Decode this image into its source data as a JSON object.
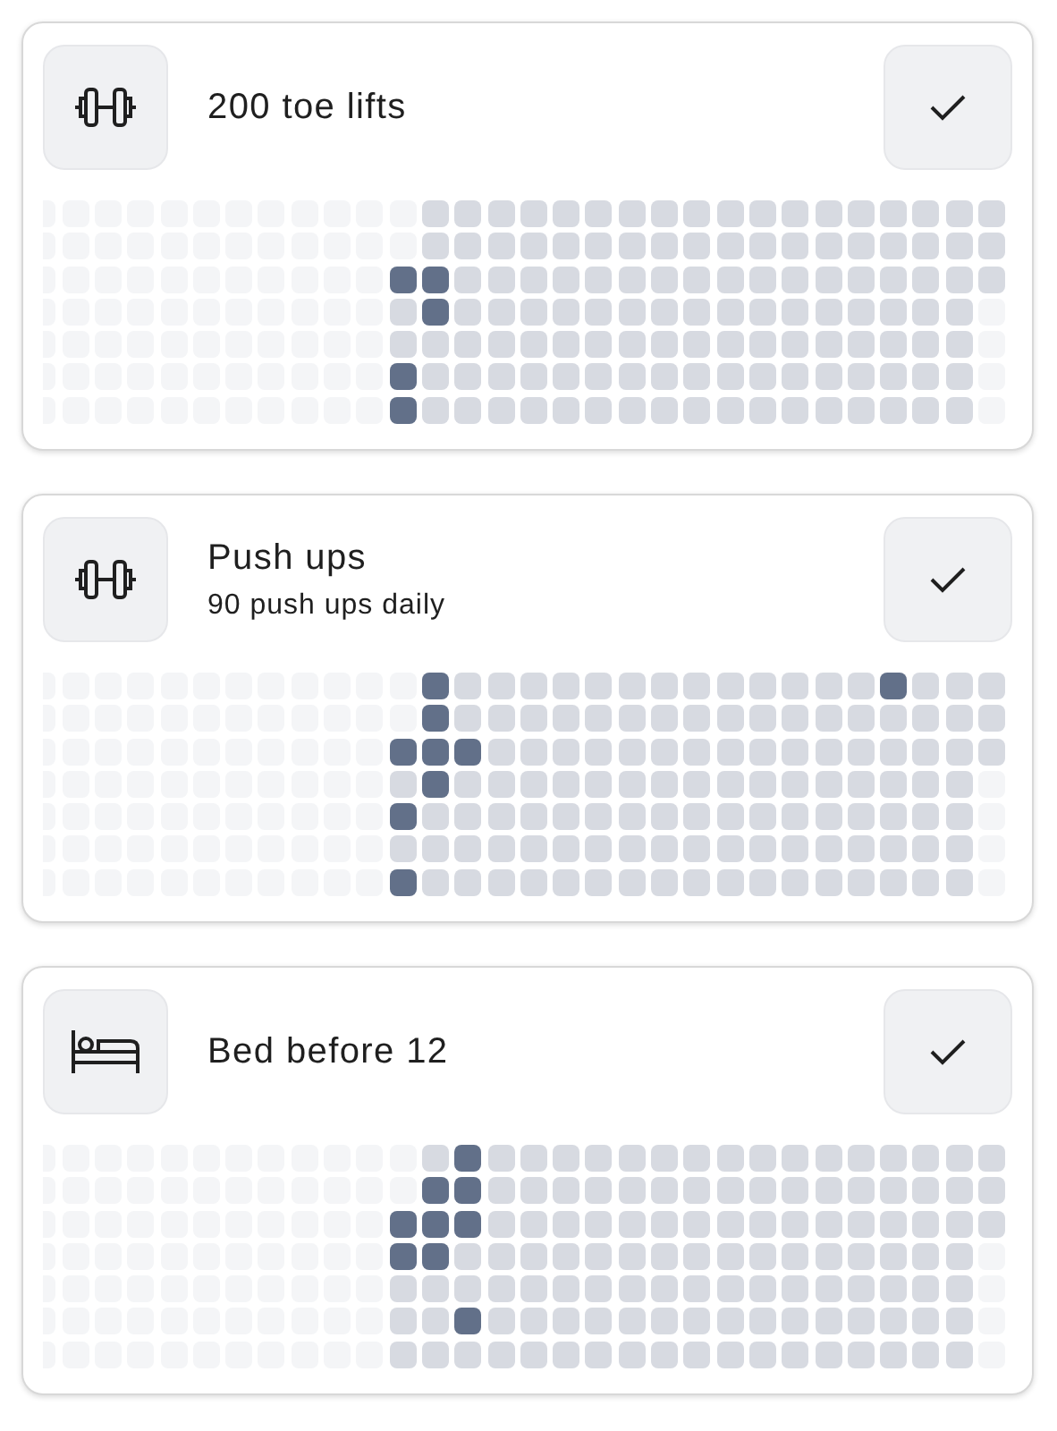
{
  "grid": {
    "disabled": [
      [
        true,
        true,
        true,
        true,
        true,
        true,
        true,
        true,
        true,
        true,
        true,
        true,
        false,
        false,
        false,
        false,
        false,
        false,
        false,
        false,
        false,
        false,
        false,
        false,
        false,
        false,
        false,
        false,
        false,
        false
      ],
      [
        true,
        true,
        true,
        true,
        true,
        true,
        true,
        true,
        true,
        true,
        true,
        true,
        false,
        false,
        false,
        false,
        false,
        false,
        false,
        false,
        false,
        false,
        false,
        false,
        false,
        false,
        false,
        false,
        false,
        false
      ],
      [
        true,
        true,
        true,
        true,
        true,
        true,
        true,
        true,
        true,
        true,
        true,
        false,
        false,
        false,
        false,
        false,
        false,
        false,
        false,
        false,
        false,
        false,
        false,
        false,
        false,
        false,
        false,
        false,
        false,
        false
      ],
      [
        true,
        true,
        true,
        true,
        true,
        true,
        true,
        true,
        true,
        true,
        true,
        false,
        false,
        false,
        false,
        false,
        false,
        false,
        false,
        false,
        false,
        false,
        false,
        false,
        false,
        false,
        false,
        false,
        false,
        true
      ],
      [
        true,
        true,
        true,
        true,
        true,
        true,
        true,
        true,
        true,
        true,
        true,
        false,
        false,
        false,
        false,
        false,
        false,
        false,
        false,
        false,
        false,
        false,
        false,
        false,
        false,
        false,
        false,
        false,
        false,
        true
      ],
      [
        true,
        true,
        true,
        true,
        true,
        true,
        true,
        true,
        true,
        true,
        true,
        false,
        false,
        false,
        false,
        false,
        false,
        false,
        false,
        false,
        false,
        false,
        false,
        false,
        false,
        false,
        false,
        false,
        false,
        true
      ],
      [
        true,
        true,
        true,
        true,
        true,
        true,
        true,
        true,
        true,
        true,
        true,
        false,
        false,
        false,
        false,
        false,
        false,
        false,
        false,
        false,
        false,
        false,
        false,
        false,
        false,
        false,
        false,
        false,
        false,
        true
      ]
    ]
  },
  "habits": [
    {
      "kind": "dumbbell",
      "title": "200 toe lifts",
      "checked": [
        [
          false,
          false,
          false,
          false,
          false,
          false,
          false,
          false,
          false,
          false,
          false,
          false,
          false,
          false,
          false,
          false,
          false,
          false,
          false,
          false,
          false,
          false,
          false,
          false,
          false,
          false,
          false,
          false,
          false,
          false
        ],
        [
          false,
          false,
          false,
          false,
          false,
          false,
          false,
          false,
          false,
          false,
          false,
          false,
          false,
          false,
          false,
          false,
          false,
          false,
          false,
          false,
          false,
          false,
          false,
          false,
          false,
          false,
          false,
          false,
          false,
          false
        ],
        [
          false,
          false,
          false,
          false,
          false,
          false,
          false,
          false,
          false,
          false,
          false,
          true,
          true,
          false,
          false,
          false,
          false,
          false,
          false,
          false,
          false,
          false,
          false,
          false,
          false,
          false,
          false,
          false,
          false,
          false
        ],
        [
          false,
          false,
          false,
          false,
          false,
          false,
          false,
          false,
          false,
          false,
          false,
          false,
          true,
          false,
          false,
          false,
          false,
          false,
          false,
          false,
          false,
          false,
          false,
          false,
          false,
          false,
          false,
          false,
          false,
          false
        ],
        [
          false,
          false,
          false,
          false,
          false,
          false,
          false,
          false,
          false,
          false,
          false,
          false,
          false,
          false,
          false,
          false,
          false,
          false,
          false,
          false,
          false,
          false,
          false,
          false,
          false,
          false,
          false,
          false,
          false,
          false
        ],
        [
          false,
          false,
          false,
          false,
          false,
          false,
          false,
          false,
          false,
          false,
          false,
          true,
          false,
          false,
          false,
          false,
          false,
          false,
          false,
          false,
          false,
          false,
          false,
          false,
          false,
          false,
          false,
          false,
          false,
          false
        ],
        [
          false,
          false,
          false,
          false,
          false,
          false,
          false,
          false,
          false,
          false,
          false,
          true,
          false,
          false,
          false,
          false,
          false,
          false,
          false,
          false,
          false,
          false,
          false,
          false,
          false,
          false,
          false,
          false,
          false,
          false
        ]
      ]
    },
    {
      "kind": "dumbbell",
      "title": "Push ups",
      "subtitle": "90 push ups daily",
      "checked": [
        [
          false,
          false,
          false,
          false,
          false,
          false,
          false,
          false,
          false,
          false,
          false,
          false,
          true,
          false,
          false,
          false,
          false,
          false,
          false,
          false,
          false,
          false,
          false,
          false,
          false,
          false,
          true,
          false,
          false,
          false
        ],
        [
          false,
          false,
          false,
          false,
          false,
          false,
          false,
          false,
          false,
          false,
          false,
          false,
          true,
          false,
          false,
          false,
          false,
          false,
          false,
          false,
          false,
          false,
          false,
          false,
          false,
          false,
          false,
          false,
          false,
          false
        ],
        [
          false,
          false,
          false,
          false,
          false,
          false,
          false,
          false,
          false,
          false,
          false,
          true,
          true,
          true,
          false,
          false,
          false,
          false,
          false,
          false,
          false,
          false,
          false,
          false,
          false,
          false,
          false,
          false,
          false,
          false
        ],
        [
          false,
          false,
          false,
          false,
          false,
          false,
          false,
          false,
          false,
          false,
          false,
          false,
          true,
          false,
          false,
          false,
          false,
          false,
          false,
          false,
          false,
          false,
          false,
          false,
          false,
          false,
          false,
          false,
          false,
          false
        ],
        [
          false,
          false,
          false,
          false,
          false,
          false,
          false,
          false,
          false,
          false,
          false,
          true,
          false,
          false,
          false,
          false,
          false,
          false,
          false,
          false,
          false,
          false,
          false,
          false,
          false,
          false,
          false,
          false,
          false,
          false
        ],
        [
          false,
          false,
          false,
          false,
          false,
          false,
          false,
          false,
          false,
          false,
          false,
          false,
          false,
          false,
          false,
          false,
          false,
          false,
          false,
          false,
          false,
          false,
          false,
          false,
          false,
          false,
          false,
          false,
          false,
          false
        ],
        [
          false,
          false,
          false,
          false,
          false,
          false,
          false,
          false,
          false,
          false,
          false,
          true,
          false,
          false,
          false,
          false,
          false,
          false,
          false,
          false,
          false,
          false,
          false,
          false,
          false,
          false,
          false,
          false,
          false,
          false
        ]
      ]
    },
    {
      "kind": "bed",
      "title": "Bed before 12",
      "checked": [
        [
          false,
          false,
          false,
          false,
          false,
          false,
          false,
          false,
          false,
          false,
          false,
          false,
          false,
          true,
          false,
          false,
          false,
          false,
          false,
          false,
          false,
          false,
          false,
          false,
          false,
          false,
          false,
          false,
          false,
          false
        ],
        [
          false,
          false,
          false,
          false,
          false,
          false,
          false,
          false,
          false,
          false,
          false,
          false,
          true,
          true,
          false,
          false,
          false,
          false,
          false,
          false,
          false,
          false,
          false,
          false,
          false,
          false,
          false,
          false,
          false,
          false
        ],
        [
          false,
          false,
          false,
          false,
          false,
          false,
          false,
          false,
          false,
          false,
          false,
          true,
          true,
          true,
          false,
          false,
          false,
          false,
          false,
          false,
          false,
          false,
          false,
          false,
          false,
          false,
          false,
          false,
          false,
          false
        ],
        [
          false,
          false,
          false,
          false,
          false,
          false,
          false,
          false,
          false,
          false,
          false,
          true,
          true,
          false,
          false,
          false,
          false,
          false,
          false,
          false,
          false,
          false,
          false,
          false,
          false,
          false,
          false,
          false,
          false,
          false
        ],
        [
          false,
          false,
          false,
          false,
          false,
          false,
          false,
          false,
          false,
          false,
          false,
          false,
          false,
          false,
          false,
          false,
          false,
          false,
          false,
          false,
          false,
          false,
          false,
          false,
          false,
          false,
          false,
          false,
          false,
          false
        ],
        [
          false,
          false,
          false,
          false,
          false,
          false,
          false,
          false,
          false,
          false,
          false,
          false,
          false,
          true,
          false,
          false,
          false,
          false,
          false,
          false,
          false,
          false,
          false,
          false,
          false,
          false,
          false,
          false,
          false,
          false
        ],
        [
          false,
          false,
          false,
          false,
          false,
          false,
          false,
          false,
          false,
          false,
          false,
          false,
          false,
          false,
          false,
          false,
          false,
          false,
          false,
          false,
          false,
          false,
          false,
          false,
          false,
          false,
          false,
          false,
          false,
          false
        ]
      ]
    }
  ]
}
